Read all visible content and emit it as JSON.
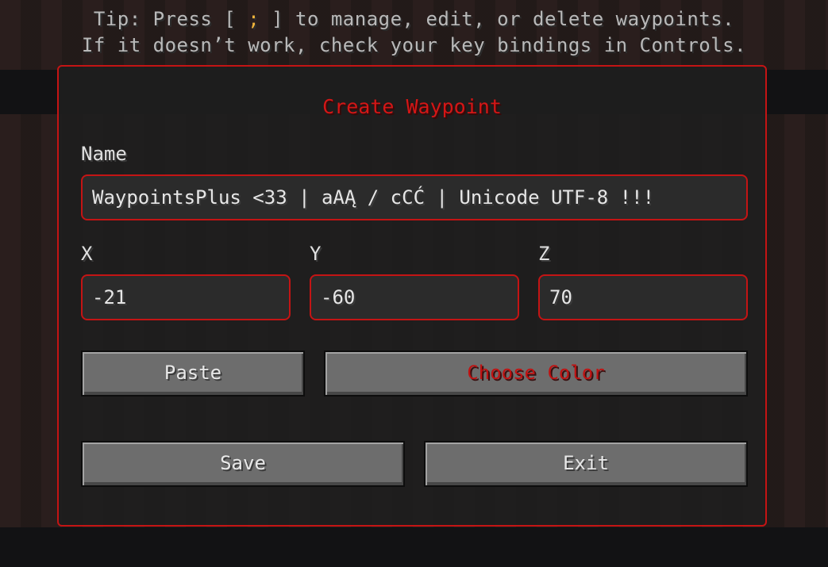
{
  "tip": {
    "line1_prefix": "Tip: Press [",
    "line1_key": ";",
    "line1_suffix": "] to manage, edit, or delete waypoints.",
    "line2": "If it doesn’t work, check your key bindings in Controls."
  },
  "dialog": {
    "title": "Create Waypoint",
    "name_label": "Name",
    "name_value": "WaypointsPlus <33  | aAĄ / cCĆ | Unicode UTF-8 !!!",
    "x_label": "X",
    "x_value": "-21",
    "y_label": "Y",
    "y_value": "-60",
    "z_label": "Z",
    "z_value": "70",
    "paste_label": "Paste",
    "choose_color_label": "Choose Color",
    "save_label": "Save",
    "exit_label": "Exit"
  },
  "colors": {
    "accent": "#c41414",
    "key_highlight": "#f0b43c"
  }
}
